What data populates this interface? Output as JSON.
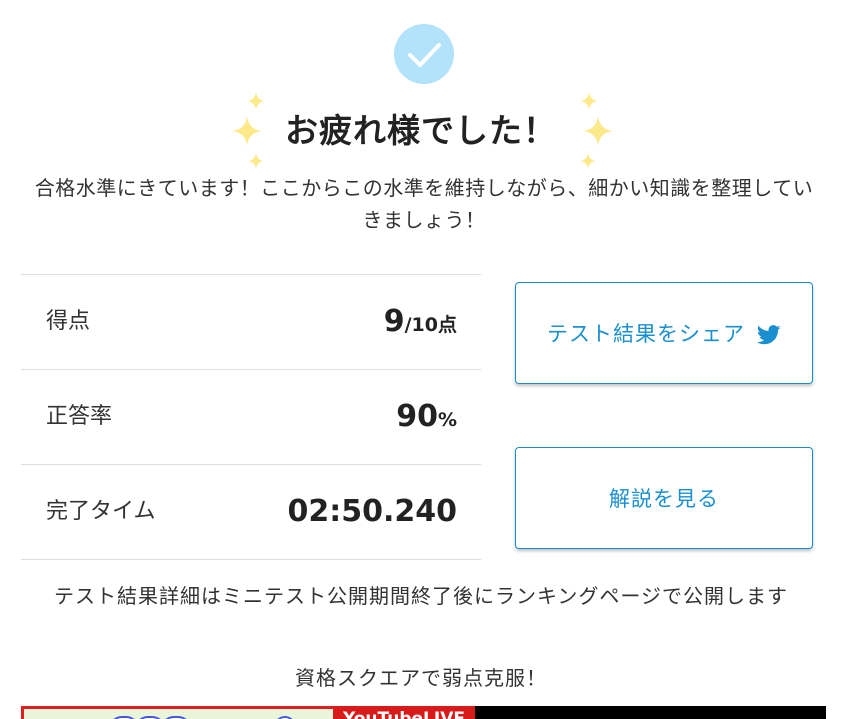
{
  "header": {
    "check_icon": "check-icon",
    "sparkle_icon": "sparkle-icon",
    "title": "お疲れ様でした！",
    "message": "合格水準にきています！ここからこの水準を維持しながら、細かい知識を整理していきましょう！"
  },
  "results": {
    "rows": [
      {
        "label": "得点",
        "value": "9",
        "unit": "/10点"
      },
      {
        "label": "正答率",
        "value": "90",
        "unit": "%"
      },
      {
        "label": "完了タイム",
        "value": "02:50.240",
        "unit": ""
      }
    ]
  },
  "actions": {
    "share_label": "テスト結果をシェア",
    "share_icon": "twitter-icon",
    "explain_label": "解説を見る"
  },
  "notice": "テスト結果詳細はミニテスト公開期間終了後にランキングページで公開します",
  "promo": {
    "heading": "資格スクエアで弱点克服！",
    "banner_badge": "YouTubeLIVE"
  },
  "colors": {
    "accent": "#1a8fd0",
    "check_circle": "#b3e2fb",
    "sparkle": "#fbe98a"
  }
}
